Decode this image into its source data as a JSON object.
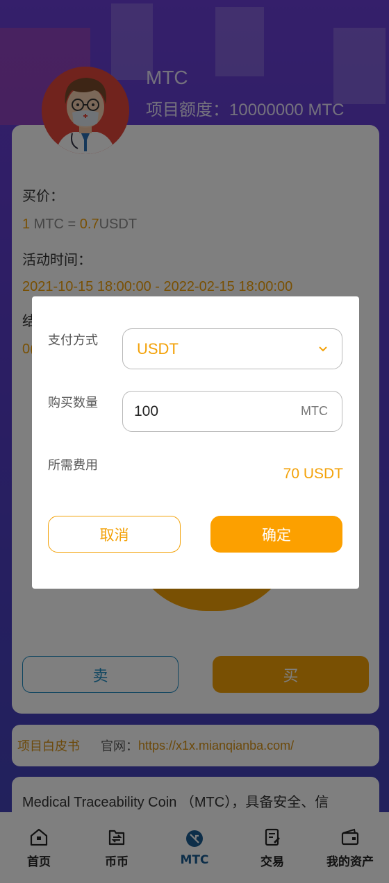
{
  "hero": {
    "name": "MTC",
    "quota_label": "项目额度：",
    "quota_value": "10000000 MTC"
  },
  "card": {
    "buy_price_label": "买价：",
    "price_qty": "1",
    "price_mid": " MTC = ",
    "price_value": "0.7",
    "price_unit": "USDT",
    "activity_label": "活动时间：",
    "activity_range": "2021-10-15 18:00:00 - 2022-02-15 18:00:00",
    "partial_label": "结",
    "partial_value": "0(",
    "sell_label": "卖",
    "buy_label": "买"
  },
  "links": {
    "whitepaper": "项目白皮书",
    "website_label": "官网：",
    "website_url": "https://x1x.mianqianba.com/"
  },
  "description": "Medical Traceability Coin （MTC），具备安全、信",
  "modal": {
    "payment_label": "支付方式",
    "payment_value": "USDT",
    "quantity_label": "购买数量",
    "quantity_value": "100",
    "quantity_unit": "MTC",
    "fee_label": "所需费用",
    "fee_value": "70 USDT",
    "cancel_label": "取消",
    "confirm_label": "确定"
  },
  "tabbar": {
    "items": [
      {
        "label": "首页",
        "icon": "home-icon"
      },
      {
        "label": "币币",
        "icon": "exchange-icon"
      },
      {
        "label": "MTC",
        "icon": "mtc-icon"
      },
      {
        "label": "交易",
        "icon": "trade-icon"
      },
      {
        "label": "我的资产",
        "icon": "wallet-icon"
      }
    ],
    "active": "MTC"
  },
  "colors": {
    "accent": "#f3a107",
    "primary_blue": "#1d8ac0",
    "active_tab": "#1b5d92"
  }
}
